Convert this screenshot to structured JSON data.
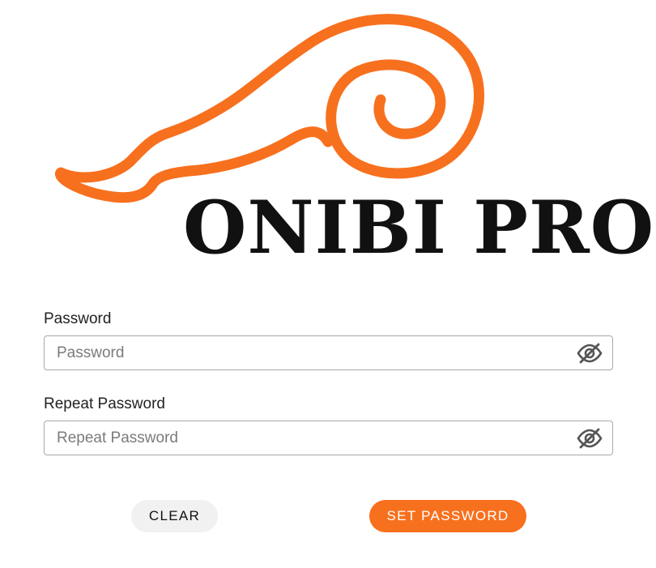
{
  "logo": {
    "text": "ONIBI PRO",
    "swirl_icon": "flame-swirl-icon",
    "accent_color": "#f7701e"
  },
  "form": {
    "password": {
      "label": "Password",
      "placeholder": "Password",
      "value": "",
      "toggle_icon": "eye-slash-icon"
    },
    "repeat_password": {
      "label": "Repeat Password",
      "placeholder": "Repeat Password",
      "value": "",
      "toggle_icon": "eye-slash-icon"
    }
  },
  "actions": {
    "clear_label": "CLEAR",
    "set_password_label": "SET PASSWORD"
  }
}
